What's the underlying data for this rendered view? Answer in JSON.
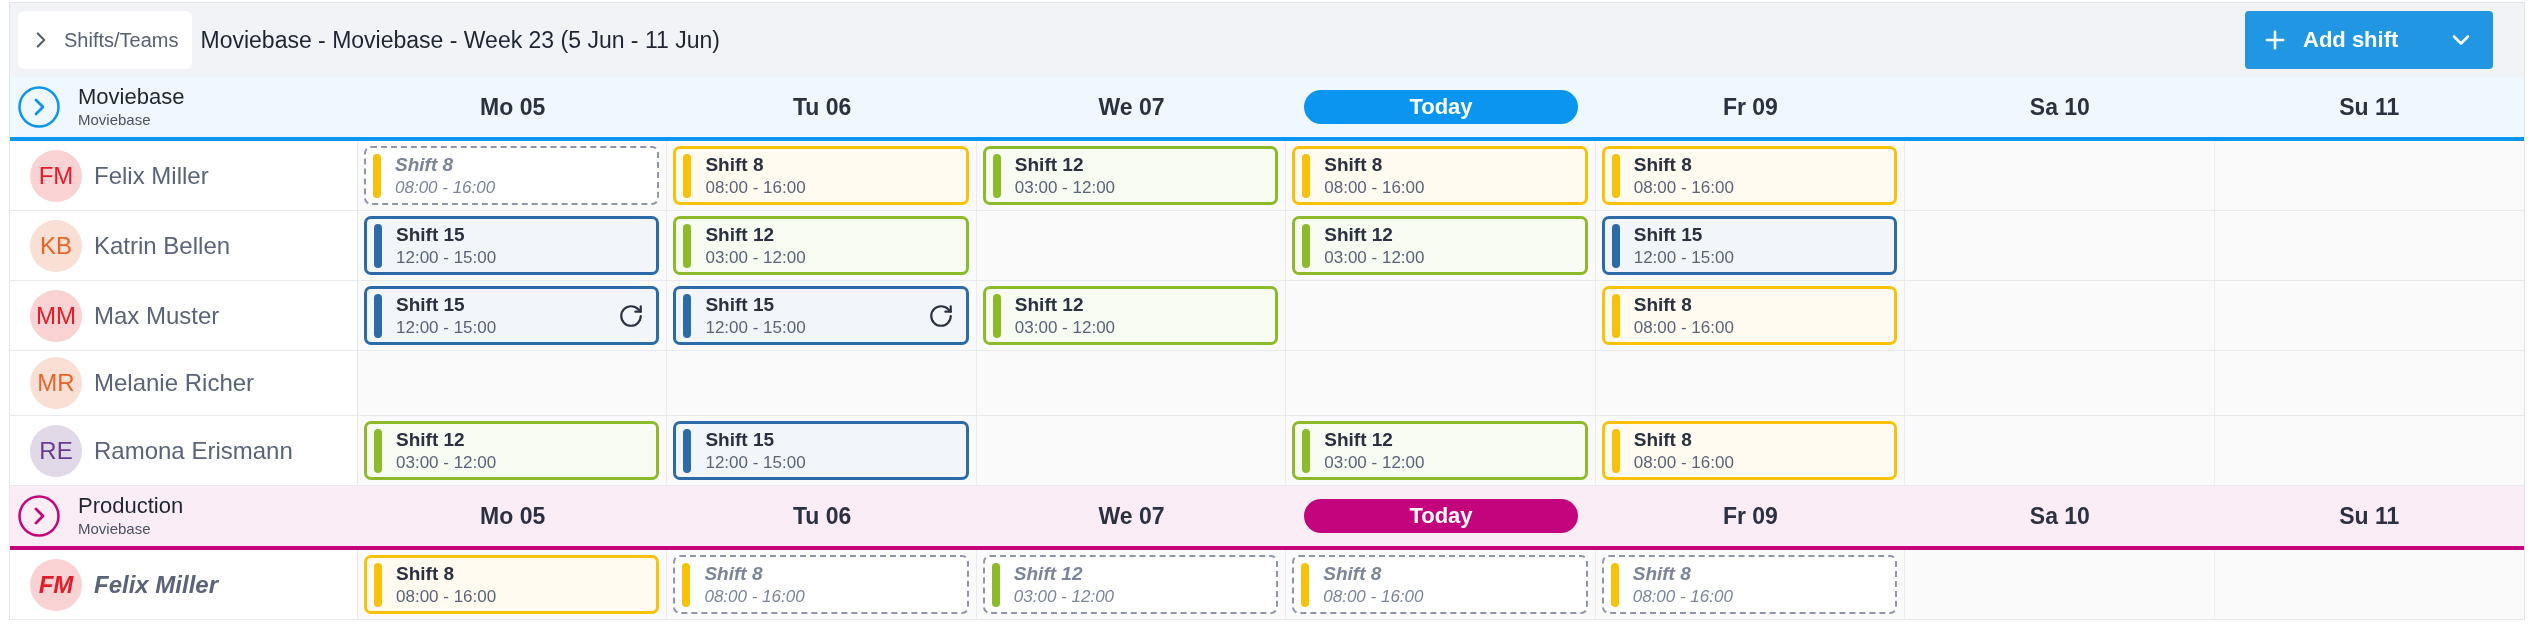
{
  "toolbar": {
    "back_button": "Shifts/Teams",
    "title": "Moviebase - Moviebase - Week 23 (5 Jun - 11 Jun)",
    "add_button": "Add shift"
  },
  "teams": [
    {
      "name": "Moviebase",
      "subtitle": "Moviebase",
      "color": "#0a96f0",
      "days": [
        {
          "label": "Mo 05",
          "today": false
        },
        {
          "label": "Tu 06",
          "today": false
        },
        {
          "label": "We 07",
          "today": false
        },
        {
          "label": "Today",
          "today": true
        },
        {
          "label": "Fr 09",
          "today": false
        },
        {
          "label": "Sa 10",
          "today": false
        },
        {
          "label": "Su 11",
          "today": false
        }
      ],
      "members": [
        {
          "initials": "FM",
          "name": "Felix Miller",
          "color": "#e11d2a",
          "guest": false,
          "cells": [
            {
              "title": "Shift 8",
              "time": "08:00 - 16:00",
              "color": "#f9c20a",
              "published": false,
              "recurring": false
            },
            {
              "title": "Shift 8",
              "time": "08:00 - 16:00",
              "color": "#f9c20a",
              "published": true,
              "recurring": false
            },
            {
              "title": "Shift 12",
              "time": "03:00 - 12:00",
              "color": "#8cba2a",
              "published": true,
              "recurring": false
            },
            {
              "title": "Shift 8",
              "time": "08:00 - 16:00",
              "color": "#f9c20a",
              "published": true,
              "recurring": false
            },
            {
              "title": "Shift 8",
              "time": "08:00 - 16:00",
              "color": "#f9c20a",
              "published": true,
              "recurring": false
            },
            null,
            null
          ]
        },
        {
          "initials": "KB",
          "name": "Katrin Bellen",
          "color": "#e8652a",
          "guest": false,
          "cells": [
            {
              "title": "Shift 15",
              "time": "12:00 - 15:00",
              "color": "#2d6aa8",
              "published": true,
              "recurring": false
            },
            {
              "title": "Shift 12",
              "time": "03:00 - 12:00",
              "color": "#8cba2a",
              "published": true,
              "recurring": false
            },
            null,
            {
              "title": "Shift 12",
              "time": "03:00 - 12:00",
              "color": "#8cba2a",
              "published": true,
              "recurring": false
            },
            {
              "title": "Shift 15",
              "time": "12:00 - 15:00",
              "color": "#2d6aa8",
              "published": true,
              "recurring": false
            },
            null,
            null
          ]
        },
        {
          "initials": "MM",
          "name": "Max Muster",
          "color": "#e11d2a",
          "guest": false,
          "cells": [
            {
              "title": "Shift 15",
              "time": "12:00 - 15:00",
              "color": "#2d6aa8",
              "published": true,
              "recurring": true
            },
            {
              "title": "Shift 15",
              "time": "12:00 - 15:00",
              "color": "#2d6aa8",
              "published": true,
              "recurring": true
            },
            {
              "title": "Shift 12",
              "time": "03:00 - 12:00",
              "color": "#8cba2a",
              "published": true,
              "recurring": false
            },
            null,
            {
              "title": "Shift 8",
              "time": "08:00 - 16:00",
              "color": "#f9c20a",
              "published": true,
              "recurring": false
            },
            null,
            null
          ]
        },
        {
          "initials": "MR",
          "name": "Melanie Richer",
          "color": "#e8652a",
          "guest": false,
          "cells": [
            null,
            null,
            null,
            null,
            null,
            null,
            null
          ]
        },
        {
          "initials": "RE",
          "name": "Ramona Erismann",
          "color": "#6b3a8e",
          "guest": false,
          "cells": [
            {
              "title": "Shift 12",
              "time": "03:00 - 12:00",
              "color": "#8cba2a",
              "published": true,
              "recurring": false
            },
            {
              "title": "Shift 15",
              "time": "12:00 - 15:00",
              "color": "#2d6aa8",
              "published": true,
              "recurring": false
            },
            null,
            {
              "title": "Shift 12",
              "time": "03:00 - 12:00",
              "color": "#8cba2a",
              "published": true,
              "recurring": false
            },
            {
              "title": "Shift 8",
              "time": "08:00 - 16:00",
              "color": "#f9c20a",
              "published": true,
              "recurring": false
            },
            null,
            null
          ]
        }
      ]
    },
    {
      "name": "Production",
      "subtitle": "Moviebase",
      "color": "#c4047c",
      "days": [
        {
          "label": "Mo 05",
          "today": false
        },
        {
          "label": "Tu 06",
          "today": false
        },
        {
          "label": "We 07",
          "today": false
        },
        {
          "label": "Today",
          "today": true
        },
        {
          "label": "Fr 09",
          "today": false
        },
        {
          "label": "Sa 10",
          "today": false
        },
        {
          "label": "Su 11",
          "today": false
        }
      ],
      "members": [
        {
          "initials": "FM",
          "name": "Felix Miller",
          "color": "#e11d2a",
          "guest": true,
          "cells": [
            {
              "title": "Shift 8",
              "time": "08:00 - 16:00",
              "color": "#f9c20a",
              "published": true,
              "recurring": false
            },
            {
              "title": "Shift 8",
              "time": "08:00 - 16:00",
              "color": "#f9c20a",
              "published": false,
              "recurring": false
            },
            {
              "title": "Shift 12",
              "time": "03:00 - 12:00",
              "color": "#8cba2a",
              "published": false,
              "recurring": false
            },
            {
              "title": "Shift 8",
              "time": "08:00 - 16:00",
              "color": "#f9c20a",
              "published": false,
              "recurring": false
            },
            {
              "title": "Shift 8",
              "time": "08:00 - 16:00",
              "color": "#f9c20a",
              "published": false,
              "recurring": false
            },
            null,
            null
          ]
        }
      ]
    }
  ]
}
